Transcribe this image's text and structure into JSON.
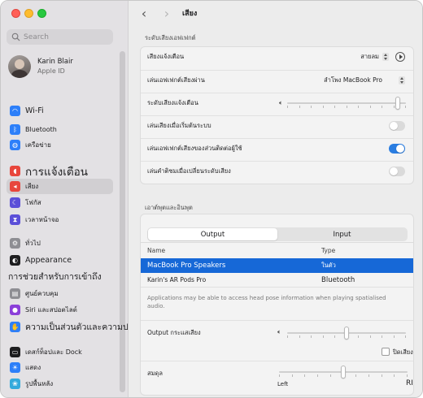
{
  "search": {
    "placeholder": "Search"
  },
  "profile": {
    "name": "Karin Blair",
    "subtitle": "Apple ID"
  },
  "sidebar": {
    "items": [
      {
        "label": "Wi-Fi",
        "icon": "wifi-icon",
        "color": "#2d7ff9",
        "size": "med"
      },
      {
        "label": "Bluetooth",
        "icon": "bluetooth-icon",
        "color": "#2d7ff9",
        "size": ""
      },
      {
        "label": "เครือข่าย",
        "icon": "globe-icon",
        "color": "#2d7ff9",
        "size": ""
      },
      {
        "label": "การแจ้งเตือน",
        "icon": "bell-icon",
        "color": "#e8463c",
        "size": "huge"
      },
      {
        "label": "เสียง",
        "icon": "speaker-icon",
        "color": "#e8463c",
        "size": ""
      },
      {
        "label": "โฟกัส",
        "icon": "moon-icon",
        "color": "#5b4fd8",
        "size": ""
      },
      {
        "label": "เวลาหน้าจอ",
        "icon": "hourglass-icon",
        "color": "#5b4fd8",
        "size": ""
      },
      {
        "label": "ทั่วไป",
        "icon": "gear-icon",
        "color": "#8e8e93",
        "size": ""
      },
      {
        "label": "Appearance",
        "icon": "appearance-icon",
        "color": "#1d1d1f",
        "size": "med"
      },
      {
        "label": "การช่วยสำหรับการเข้าถึง",
        "icon": "",
        "color": "",
        "size": "big"
      },
      {
        "label": "ศูนย์ควบคุม",
        "icon": "control-center-icon",
        "color": "#8e8e93",
        "size": ""
      },
      {
        "label": "Siri และสปอตไลต์",
        "icon": "siri-icon",
        "color": "#8b3fd9",
        "size": ""
      },
      {
        "label": "ความเป็นส่วนตัวและความปลอดภัย",
        "icon": "hand-icon",
        "color": "#2d7ff9",
        "size": "big"
      },
      {
        "label": "เดสก์ท็อปและ Dock",
        "icon": "dock-icon",
        "color": "#1d1d1f",
        "size": ""
      },
      {
        "label": "แสดง",
        "icon": "display-icon",
        "color": "#2d7ff9",
        "size": ""
      },
      {
        "label": "รูปพื้นหลัง",
        "icon": "wallpaper-icon",
        "color": "#34aadc",
        "size": ""
      }
    ],
    "selected_index": 4
  },
  "toolbar": {
    "title": "เสียง"
  },
  "sound_effects": {
    "heading": "ระดับเสียงเอฟเฟกต์",
    "alert_sound_label": "เสียงแจ้งเตือน",
    "alert_sound_value": "สายลม",
    "play_through_label": "เล่นเอฟเฟกต์เสียงผ่าน",
    "play_through_value": "ลำโพง MacBook Pro",
    "alert_volume_label": "ระดับเสียงแจ้งเตือน",
    "alert_volume_level": 0.95,
    "startup_label": "เล่นเสียงเมื่อเริ่มต้นระบบ",
    "startup_on": false,
    "ui_effects_label": "เล่นเอฟเฟกต์เสียงของส่วนติดต่อผู้ใช้",
    "ui_effects_on": true,
    "feedback_label": "เล่นคำติชมเมื่อเปลี่ยนระดับเสียง",
    "feedback_on": false
  },
  "output_input": {
    "heading": "เอาต์พุตและอินพุต",
    "tabs": [
      "Output",
      "Input"
    ],
    "active_tab": 0,
    "columns": [
      "Name",
      "Type"
    ],
    "devices": [
      {
        "name": "MacBook Pro Speakers",
        "type": "ในตัว",
        "selected": true
      },
      {
        "name": "Karin's AR Pods Pro",
        "type": "Bluetooth",
        "selected": false
      }
    ],
    "note": "Applications may be able to access head pose information when playing spatialised audio.",
    "output_volume_label": "Output กระแสเสียง",
    "output_volume_level": 0.5,
    "mute_label": "ปิดเสียง",
    "mute_on": false,
    "balance_label": "สมดุล",
    "balance_level": 0.5,
    "balance_left": "Left",
    "balance_right": "RI"
  }
}
